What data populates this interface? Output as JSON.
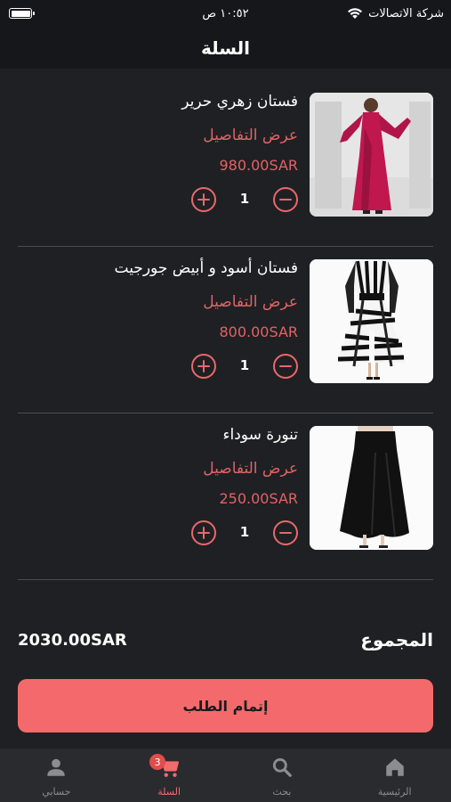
{
  "status_bar": {
    "carrier": "شركة الاتصالات",
    "time": "١٠:٥٢ ص",
    "battery_level": 1.0
  },
  "header": {
    "title": "السلة"
  },
  "cart": {
    "items": [
      {
        "name": "فستان زهري حرير",
        "details_label": "عرض التفاصيل",
        "price": "980.00SAR",
        "quantity": "1",
        "image": "pink-satin-dress"
      },
      {
        "name": "فستان أسود و أبيض جورجيت",
        "details_label": "عرض التفاصيل",
        "price": "800.00SAR",
        "quantity": "1",
        "image": "zebra-print-dress"
      },
      {
        "name": "تنورة سوداء",
        "details_label": "عرض التفاصيل",
        "price": "250.00SAR",
        "quantity": "1",
        "image": "black-skirt"
      }
    ]
  },
  "total": {
    "label": "المجموع",
    "value": "2030.00SAR"
  },
  "checkout": {
    "label": "إتمام الطلب"
  },
  "bottom_nav": {
    "items": [
      {
        "label": "الرئيسية",
        "icon": "home-icon",
        "active": false
      },
      {
        "label": "بحث",
        "icon": "search-icon",
        "active": false
      },
      {
        "label": "السلة",
        "icon": "cart-icon",
        "active": true,
        "badge": "3"
      },
      {
        "label": "حسابي",
        "icon": "person-icon",
        "active": false
      }
    ]
  },
  "colors": {
    "background": "#1f2023",
    "header": "#16171a",
    "accent": "#f46a6c",
    "link": "#e06366",
    "divider": "#4b4c50",
    "nav_background": "#2a2b2e"
  }
}
